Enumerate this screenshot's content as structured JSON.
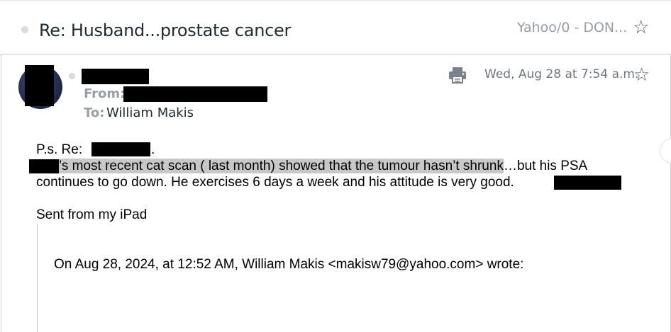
{
  "thread": {
    "subject": "Re: Husband...prostate cancer",
    "folder": "Yahoo/0 - DON..."
  },
  "message": {
    "from_label": "From:",
    "to_label": "To:",
    "to_value": "William Makis",
    "date": "Wed, Aug 28 at 7:54 a.m.",
    "body": {
      "line1_prefix": "P.s.  Re:",
      "line1_suffix": ".",
      "line2_highlighted": "’s most recent cat scan ( last month) showed that the tumour hasn’t shrunk",
      "line2_rest": "…but his PSA",
      "line3": "continues to go down.    He exercises 6 days a week and his attitude is very good.",
      "signature": "Sent from my iPad",
      "quote_header": "On Aug 28, 2024, at 12:52 AM, William Makis <makisw79@yahoo.com> wrote:"
    }
  },
  "icons": {
    "thread_star": "star-outline-icon",
    "message_star": "star-outline-icon",
    "print": "printer-icon"
  },
  "colors": {
    "highlight": "#c8c8c8",
    "muted_text": "#979ea8",
    "redaction": "#000000"
  }
}
